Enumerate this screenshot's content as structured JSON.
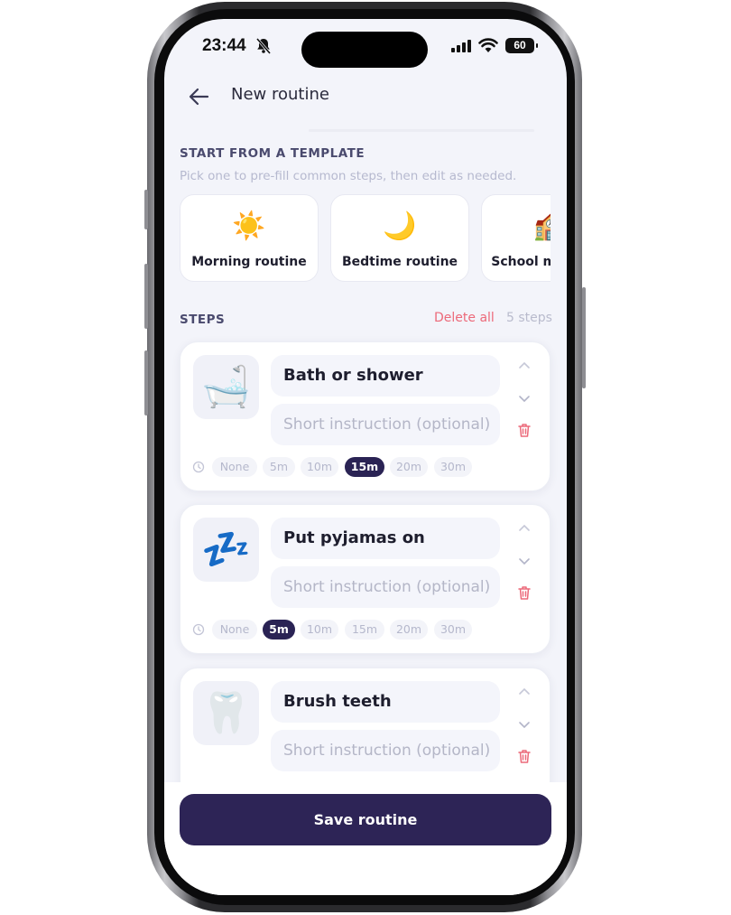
{
  "status_bar": {
    "time": "23:44",
    "battery": "60"
  },
  "header": {
    "title": "New routine"
  },
  "templates_section": {
    "label": "START FROM A TEMPLATE",
    "subtitle": "Pick one to pre-fill common steps, then edit as needed.",
    "items": [
      {
        "emoji": "☀️",
        "label": "Morning routine"
      },
      {
        "emoji": "🌙",
        "label": "Bedtime routine"
      },
      {
        "emoji": "🏫",
        "label": "School mornings"
      }
    ]
  },
  "steps_section": {
    "label": "STEPS",
    "delete_all": "Delete all",
    "count": "5 steps",
    "instruction_placeholder": "Short instruction (optional)",
    "durations": [
      "None",
      "5m",
      "10m",
      "15m",
      "20m",
      "30m"
    ],
    "steps": [
      {
        "emoji": "🛁",
        "name": "Bath or shower",
        "selected_duration": "15m"
      },
      {
        "emoji": "💤",
        "name": "Put pyjamas on",
        "selected_duration": "5m"
      },
      {
        "emoji": "🦷",
        "name": "Brush teeth",
        "selected_duration": ""
      }
    ]
  },
  "footer": {
    "save_label": "Save routine"
  },
  "colors": {
    "primary": "#2d2456",
    "danger": "#ec6a7a",
    "background": "#f3f4fa"
  }
}
